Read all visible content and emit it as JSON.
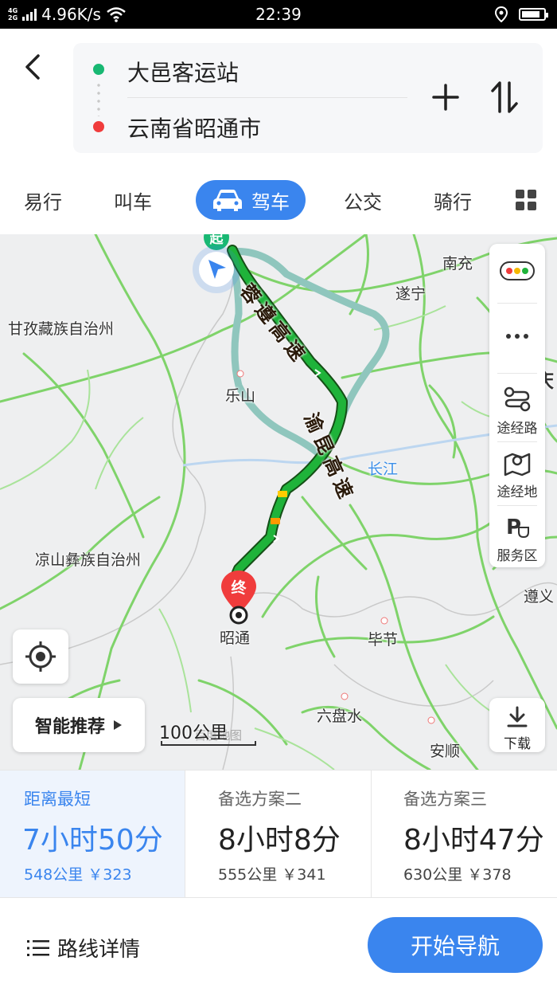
{
  "status_bar": {
    "network_top": "4G",
    "network_bottom": "2G",
    "speed": "4.96K/s",
    "time": "22:39",
    "battery_level": 0.85
  },
  "header": {
    "start": "大邑客运站",
    "end": "云南省昭通市"
  },
  "tabs": [
    {
      "label": "易行"
    },
    {
      "label": "叫车"
    },
    {
      "label": "驾车",
      "active": true
    },
    {
      "label": "公交"
    },
    {
      "label": "骑行"
    }
  ],
  "map": {
    "labels": {
      "nanchong": "南充",
      "suining": "遂宁",
      "ganzi": "甘孜藏族自治州",
      "leshan": "乐山",
      "chongqing": "重庆",
      "changjiang": "长江",
      "liangshan": "凉山彝族自治州",
      "zunyi": "遵义",
      "bijie": "毕节",
      "zhaotong": "昭通",
      "liupanshui": "六盘水",
      "anshun": "安顺"
    },
    "start_marker": "起",
    "end_marker": "终",
    "highway_1": "蓉遵高速",
    "highway_2": "渝昆高速",
    "scale": "100公里",
    "watermark": "百度地图",
    "controls": {
      "waypoint_route": "途经路",
      "waypoint_place": "途经地",
      "service_area": "服务区",
      "download": "下载"
    },
    "smart_recommend": "智能推荐"
  },
  "plans": [
    {
      "label": "距离最短",
      "time": "7小时50分",
      "meta": "548公里 ￥323",
      "selected": true
    },
    {
      "label": "备选方案二",
      "time": "8小时8分",
      "meta": "555公里 ￥341"
    },
    {
      "label": "备选方案三",
      "time": "8小时47分",
      "meta": "630公里 ￥378"
    }
  ],
  "bottom": {
    "details": "路线详情",
    "start_nav": "开始导航"
  },
  "colors": {
    "accent": "#3a85ee",
    "route_main": "#1fb33a",
    "route_alt": "#8fc6bd",
    "start_green": "#18b873",
    "end_red": "#f03c3c"
  }
}
